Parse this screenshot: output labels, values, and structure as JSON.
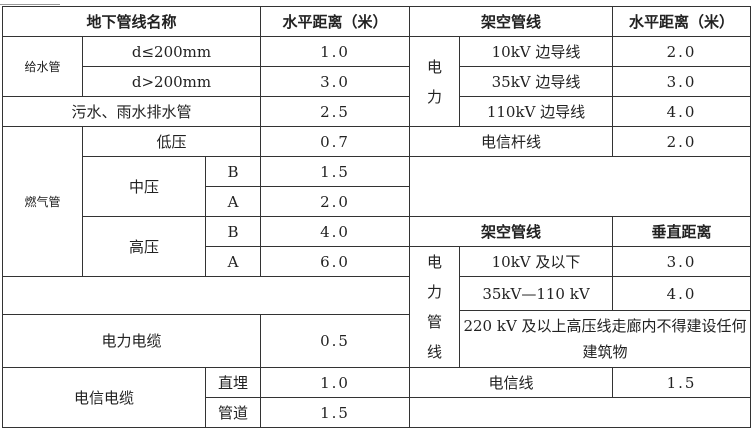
{
  "headers": {
    "underground_name": "地下管线名称",
    "horizontal_distance_left": "水平距离（米）",
    "overhead_lines": "架空管线",
    "horizontal_distance_right": "水平距离（米）",
    "overhead_lines_2": "架空管线",
    "vertical_distance": "垂直距离"
  },
  "water_supply": {
    "label": "给水管",
    "rows": [
      {
        "condition": "d≤200mm",
        "value": "1.0"
      },
      {
        "condition": "d>200mm",
        "value": "3.0"
      }
    ]
  },
  "sewer": {
    "label": "污水、雨水排水管",
    "value": "2.5"
  },
  "gas": {
    "label": "燃气管",
    "low": {
      "label": "低压",
      "value": "0.7"
    },
    "medium": {
      "label": "中压",
      "rows": [
        {
          "grade": "B",
          "value": "1.5"
        },
        {
          "grade": "A",
          "value": "2.0"
        }
      ]
    },
    "high": {
      "label": "高压",
      "rows": [
        {
          "grade": "B",
          "value": "4.0"
        },
        {
          "grade": "A",
          "value": "6.0"
        }
      ]
    }
  },
  "power_cable": {
    "label": "电力电缆",
    "value": "0.5"
  },
  "telecom_cable": {
    "label": "电信电缆",
    "rows": [
      {
        "method": "直埋",
        "value": "1.0"
      },
      {
        "method": "管道",
        "value": "1.5"
      }
    ]
  },
  "overhead_power": {
    "group_label": "电力",
    "rows": [
      {
        "line": "10kV 边导线",
        "value": "2.0"
      },
      {
        "line": "35kV 边导线",
        "value": "3.0"
      },
      {
        "line": "110kV 边导线",
        "value": "4.0"
      }
    ]
  },
  "telecom_pole": {
    "label": "电信杆线",
    "value": "2.0"
  },
  "overhead_power_vertical": {
    "group_label": "电力管线",
    "rows": [
      {
        "line": "10kV 及以下",
        "value": "3.0"
      },
      {
        "line": "35kV—110 kV",
        "value": "4.0"
      }
    ],
    "note": "220 kV 及以上高压线走廊内不得建设任何建筑物"
  },
  "telecom_line": {
    "label": "电信线",
    "value": "1.5"
  }
}
